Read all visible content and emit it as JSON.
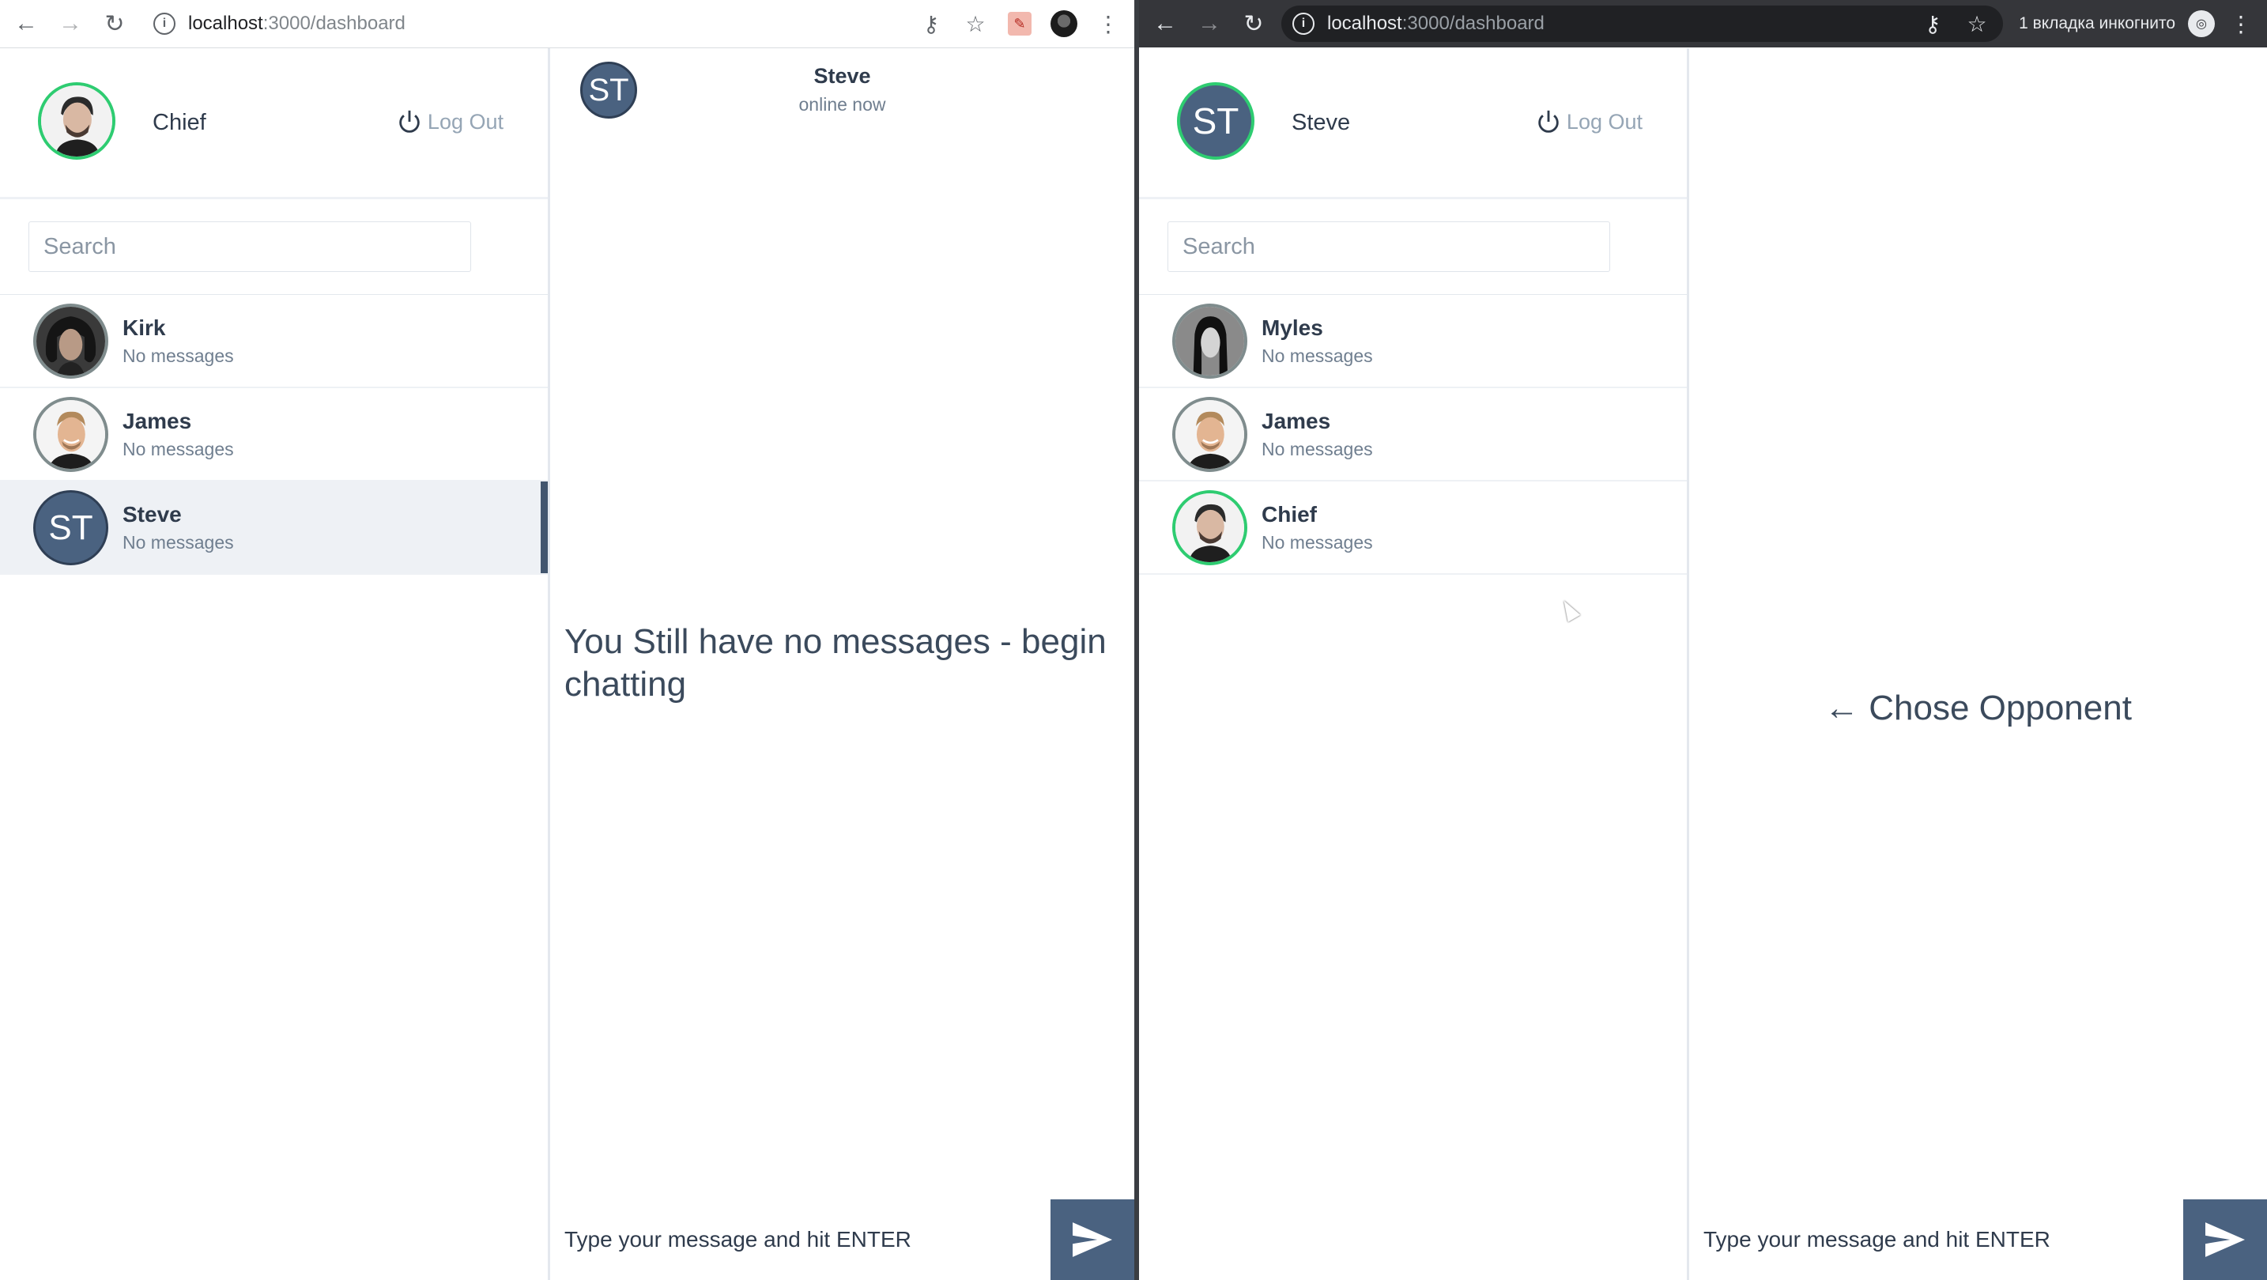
{
  "windows": {
    "left": {
      "browser": {
        "url_host": "localhost",
        "url_path": ":3000/dashboard"
      },
      "profile": {
        "name": "Chief",
        "logout_label": "Log Out"
      },
      "search": {
        "placeholder": "Search"
      },
      "contacts": [
        {
          "name": "Kirk",
          "status": "No messages"
        },
        {
          "name": "James",
          "status": "No messages"
        },
        {
          "name": "Steve",
          "initials": "ST",
          "status": "No messages",
          "active": true
        }
      ],
      "chat": {
        "header_initials": "ST",
        "header_name": "Steve",
        "header_status": "online now",
        "empty_text": "You Still have no messages - begin chatting",
        "input_placeholder": "Type your message and hit ENTER"
      }
    },
    "right": {
      "browser": {
        "url_host": "localhost",
        "url_path": ":3000/dashboard",
        "incognito_label": "1 вкладка инкогнито"
      },
      "profile": {
        "initials": "ST",
        "name": "Steve",
        "logout_label": "Log Out"
      },
      "search": {
        "placeholder": "Search"
      },
      "contacts": [
        {
          "name": "Myles",
          "status": "No messages"
        },
        {
          "name": "James",
          "status": "No messages"
        },
        {
          "name": "Chief",
          "status": "No messages"
        }
      ],
      "chat": {
        "prompt_text": "← Chose Opponent",
        "input_placeholder": "Type your message and hit ENTER"
      }
    }
  },
  "colors": {
    "accent": "#4a6280",
    "online": "#2ecc71",
    "offline": "#7f8c8d",
    "text": "#2f3b4c",
    "muted": "#6f7e8f"
  },
  "icons": [
    "back-icon",
    "forward-icon",
    "reload-icon",
    "info-icon",
    "key-icon",
    "star-icon",
    "pdf-extension-icon",
    "menu-icon",
    "power-icon",
    "send-icon",
    "incognito-icon"
  ]
}
